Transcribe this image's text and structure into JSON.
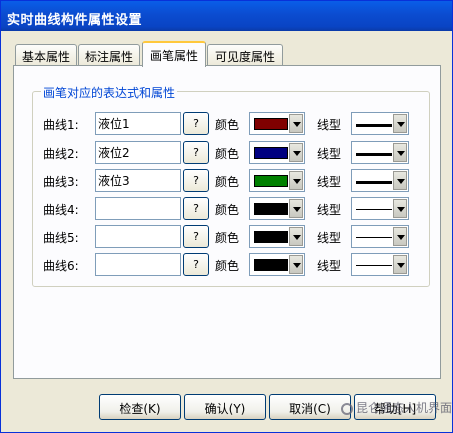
{
  "window": {
    "title": "实时曲线构件属性设置"
  },
  "tabs": [
    {
      "label": "基本属性"
    },
    {
      "label": "标注属性"
    },
    {
      "label": "画笔属性"
    },
    {
      "label": "可见度属性"
    }
  ],
  "active_tab": 2,
  "group": {
    "title": "画笔对应的表达式和属性",
    "question_label": "?",
    "color_label": "颜色",
    "line_label": "线型",
    "curves": [
      {
        "label": "曲线1:",
        "expr": "液位1",
        "color": "#800000",
        "line": "thick"
      },
      {
        "label": "曲线2:",
        "expr": "液位2",
        "color": "#000080",
        "line": "thick"
      },
      {
        "label": "曲线3:",
        "expr": "液位3",
        "color": "#008000",
        "line": "thick"
      },
      {
        "label": "曲线4:",
        "expr": "",
        "color": "#000000",
        "line": "thin"
      },
      {
        "label": "曲线5:",
        "expr": "",
        "color": "#000000",
        "line": "thin"
      },
      {
        "label": "曲线6:",
        "expr": "",
        "color": "#000000",
        "line": "thin"
      }
    ]
  },
  "buttons": {
    "check": "检查(K)",
    "ok": "确认(Y)",
    "cancel": "取消(C)",
    "help": "帮助[H]"
  },
  "watermark": "昆仑通态人机界面"
}
